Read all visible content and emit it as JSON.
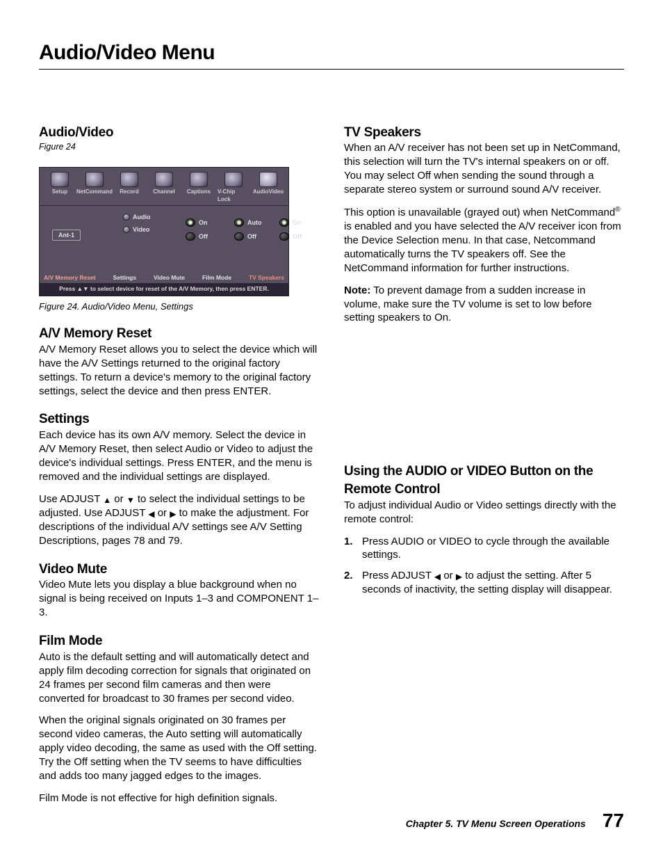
{
  "page_title": "Audio/Video Menu",
  "left": {
    "av_heading": "Audio/Video",
    "figref": "Figure 24",
    "caption": "Figure 24. Audio/Video Menu, Settings",
    "avreset_h": "A/V Memory Reset",
    "avreset_p": "A/V Memory Reset allows you to select the device which will have the A/V Settings returned to the original factory settings.  To return a device's memory to the original factory settings, select the device and then press ENTER.",
    "settings_h": "Settings",
    "settings_p1": "Each device has its own A/V memory.  Select the device in A/V Memory Reset, then select Audio or Video to adjust the device's individual settings.  Press ENTER, and the menu is removed and the individual settings are displayed.",
    "settings_p2a": "Use ADJUST ",
    "settings_p2b": " or ",
    "settings_p2c": " to select the individual settings to be adjusted.  Use ADJUST ",
    "settings_p2d": " or ",
    "settings_p2e": " to make the adjustment.  For descriptions of the individual A/V settings see A/V Setting Descriptions, pages 78 and 79.",
    "vm_h": "Video Mute",
    "vm_p": "Video Mute lets you display a blue background when no signal is being received on Inputs 1–3 and COMPONENT 1–3.",
    "fm_h": "Film Mode",
    "fm_p1": "Auto is the default setting and will automatically detect and apply film decoding correction for signals that originated on 24 frames per second film cameras and then were converted for broadcast to 30 frames per second video.",
    "fm_p2": "When the original signals originated on 30 frames per second video cameras, the Auto setting will automatically apply video decoding, the same as used with the Off setting.  Try the Off setting when the TV seems to have difficulties and adds too many jagged edges to the images.",
    "fm_p3": "Film Mode is not effective for high definition signals."
  },
  "right": {
    "tvs_h": "TV Speakers",
    "tvs_p1": "When an A/V receiver has not been set up in NetCommand, this selection will turn the TV's internal speakers on or off.  You may select Off when sending the sound through a separate stereo system or surround sound A/V receiver.",
    "tvs_p2a": "This option is unavailable (grayed out) when NetCommand",
    "tvs_p2b": " is enabled and you have selected the A/V receiver icon from the Device Selection menu.  In that case, Netcommand automatically turns the TV speakers off.  See the NetCommand information for further instructions.",
    "tvs_note_label": "Note:",
    "tvs_note": "  To prevent damage from a sudden increase in volume, make sure the TV volume is set to low before setting speakers to On.",
    "using_h": "Using the AUDIO or VIDEO Button on the Remote Control",
    "using_p": "To adjust individual Audio or Video settings directly with the remote control:",
    "step1": "Press AUDIO or VIDEO to cycle through the available settings.",
    "step2a": "Press ADJUST ",
    "step2b": " or ",
    "step2c": " to adjust the setting.  After 5 seconds of inactivity, the setting display will disappear."
  },
  "figure": {
    "tabs": [
      "Setup",
      "NetCommand",
      "Record",
      "Channel",
      "Captions",
      "V-Chip Lock",
      "AudioVideo"
    ],
    "ant": "Ant-1",
    "audio": "Audio",
    "video": "Video",
    "videomute": {
      "on": "On",
      "off": "Off"
    },
    "filmmode": {
      "auto": "Auto",
      "off": "Off"
    },
    "tvspeakers": {
      "on": "On",
      "off": "Off"
    },
    "subhdr": {
      "avreset": "A/V Memory Reset",
      "settings": "Settings",
      "vm": "Video Mute",
      "fm": "Film Mode",
      "tv": "TV Speakers"
    },
    "footer": "Press ▲▼ to select device for reset of the A/V Memory, then press ENTER."
  },
  "footer": {
    "chapter": "Chapter 5. TV Menu Screen Operations",
    "page": "77"
  }
}
